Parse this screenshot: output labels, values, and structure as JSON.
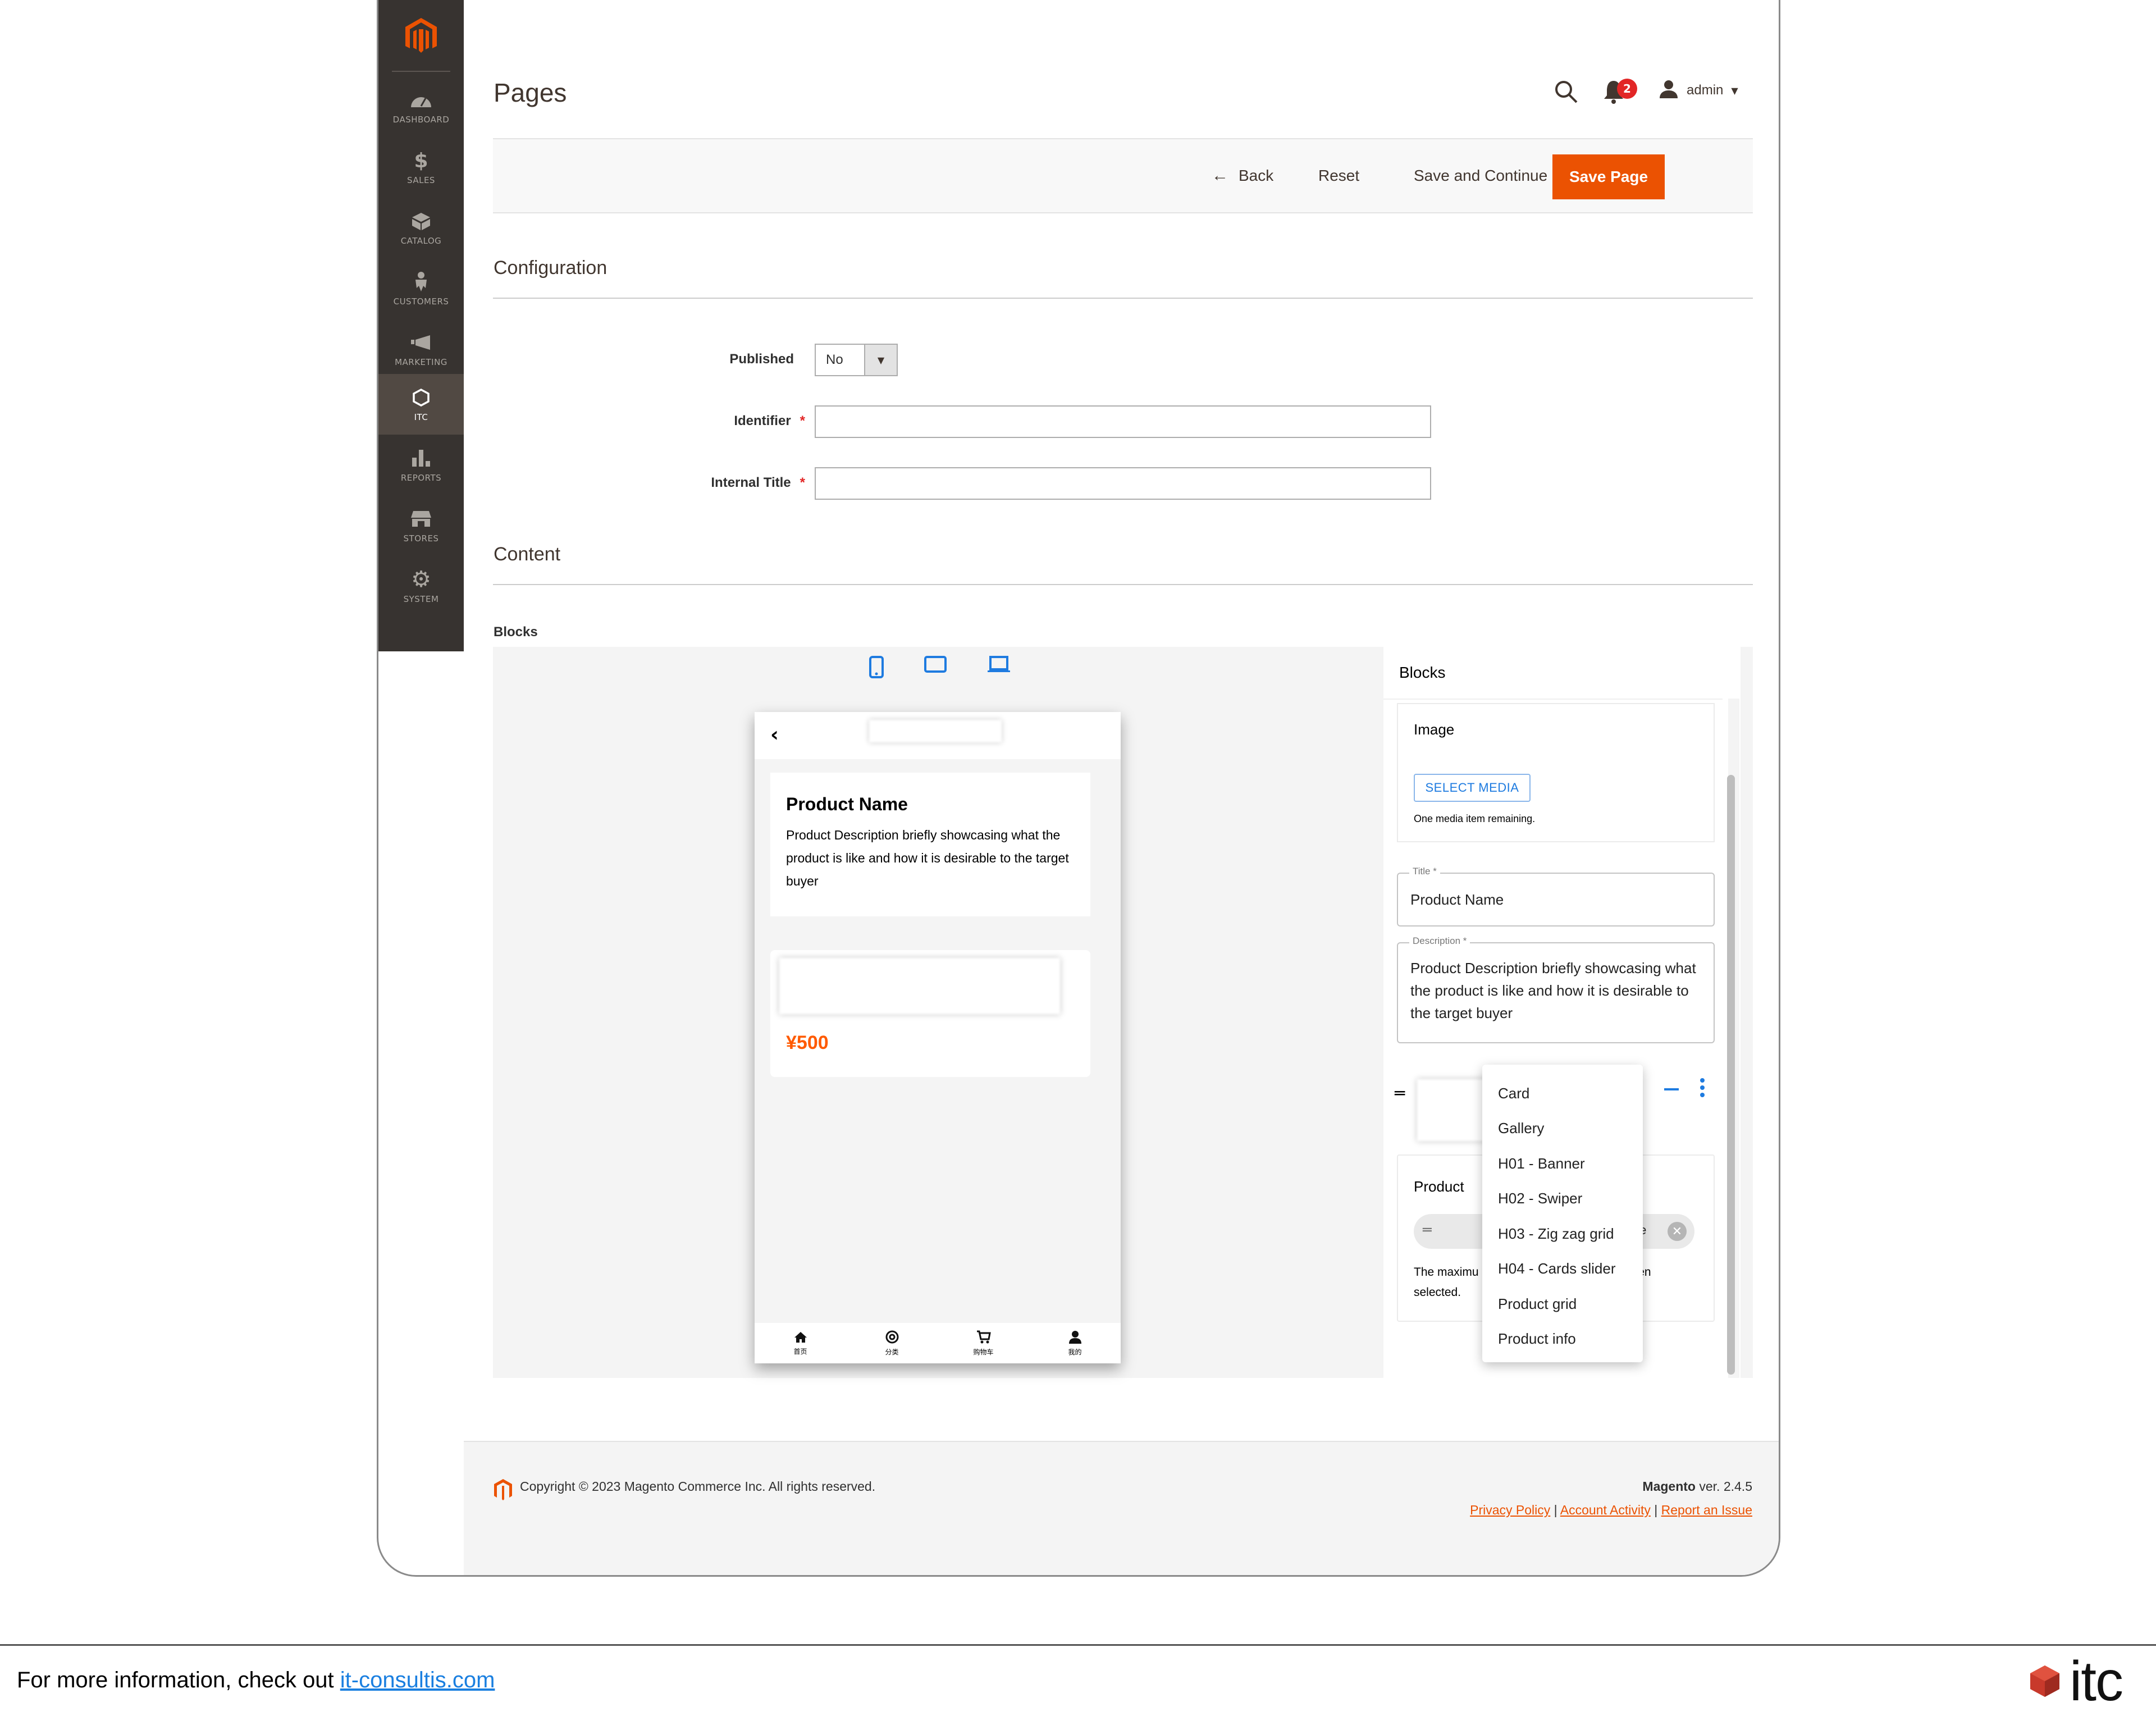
{
  "sidebar": {
    "items": [
      {
        "label": "DASHBOARD",
        "icon": "dashboard-icon"
      },
      {
        "label": "SALES",
        "icon": "dollar-icon"
      },
      {
        "label": "CATALOG",
        "icon": "box-icon"
      },
      {
        "label": "CUSTOMERS",
        "icon": "person-icon"
      },
      {
        "label": "MARKETING",
        "icon": "megaphone-icon"
      },
      {
        "label": "ITC",
        "icon": "hexagon-icon",
        "active": true
      },
      {
        "label": "REPORTS",
        "icon": "bar-chart-icon"
      },
      {
        "label": "STORES",
        "icon": "storefront-icon"
      },
      {
        "label": "SYSTEM",
        "icon": "gear-icon"
      }
    ]
  },
  "header": {
    "title": "Pages",
    "notifications_count": "2",
    "user": "admin"
  },
  "toolbar": {
    "back_label": "Back",
    "reset_label": "Reset",
    "save_continue_label": "Save and Continue Edit",
    "save_label": "Save Page"
  },
  "configuration": {
    "title": "Configuration",
    "published_label": "Published",
    "published_value": "No",
    "identifier_label": "Identifier",
    "identifier_value": "",
    "internal_title_label": "Internal Title",
    "internal_title_value": "",
    "required_mark": "*"
  },
  "content": {
    "title": "Content",
    "blocks_label": "Blocks"
  },
  "preview": {
    "back_glyph": "‹",
    "product_name": "Product Name",
    "product_description": "Product Description briefly showcasing what the product is like and how it is desirable to the target buyer",
    "price": "¥500",
    "tabs": [
      {
        "label": "首页",
        "icon": "home-icon"
      },
      {
        "label": "分类",
        "icon": "category-icon"
      },
      {
        "label": "购物车",
        "icon": "cart-icon"
      },
      {
        "label": "我的",
        "icon": "user-icon"
      }
    ]
  },
  "blocks_panel": {
    "title": "Blocks",
    "image_block": {
      "title": "Image",
      "select_media_label": "SELECT MEDIA",
      "note": "One media item remaining."
    },
    "title_field": {
      "label": "Title",
      "value": "Product Name"
    },
    "description_field": {
      "label": "Description",
      "value": "Product Description briefly showcasing what the product is like and how it is desirable to the target buyer"
    },
    "product_block": {
      "title": "Product",
      "chip_text_partial": "te",
      "note_partial_left": "The maximu",
      "note_partial_right": "een",
      "note_line2": "selected."
    }
  },
  "block_type_menu": {
    "items": [
      "Card",
      "Gallery",
      "H01 - Banner",
      "H02 - Swiper",
      "H03 - Zig zag grid",
      "H04 - Cards slider",
      "Product grid",
      "Product info"
    ]
  },
  "footer": {
    "copyright": "Copyright © 2023 Magento Commerce Inc. All rights reserved.",
    "brand": "Magento",
    "version": " ver. 2.4.5",
    "links": [
      "Privacy Policy",
      "Account Activity",
      "Report an Issue"
    ],
    "separator": " | "
  },
  "banner": {
    "text": "For more information, check out ",
    "link": "it-consultis.com",
    "logo_text": "itc"
  },
  "colors": {
    "accent": "#eb5202",
    "sidebar": "#373330",
    "link_blue": "#1e7be0",
    "price": "#ff5a00"
  }
}
